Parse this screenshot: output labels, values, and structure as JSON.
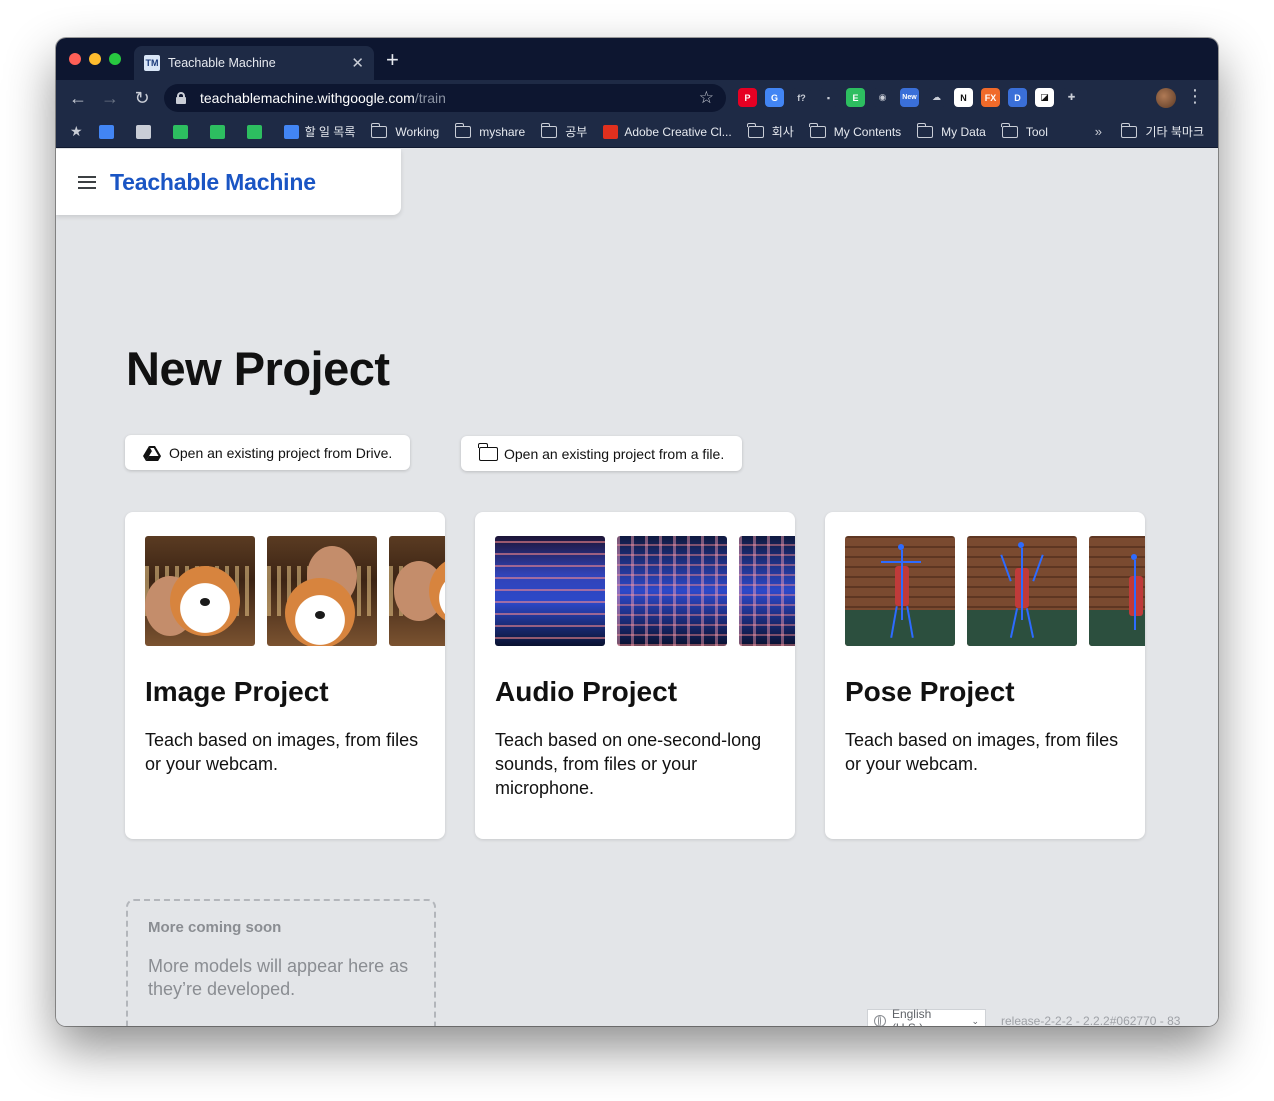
{
  "browser": {
    "tab_title": "Teachable Machine",
    "tab_favicon": "TM",
    "url_host": "teachablemachine.withgoogle.com",
    "url_path": "/train",
    "extensions": [
      {
        "icon": "pinterest-icon",
        "color": "#e60023",
        "label": "P"
      },
      {
        "icon": "translate-icon",
        "color": "#4285f4",
        "label": "G"
      },
      {
        "icon": "formula-icon",
        "color": "#1e2a45",
        "label": "f?"
      },
      {
        "icon": "screen-icon",
        "color": "#1e2a45",
        "label": "▪"
      },
      {
        "icon": "evernote-icon",
        "color": "#2dbe60",
        "label": "E"
      },
      {
        "icon": "camera-icon",
        "color": "#1e2a45",
        "label": "◉"
      },
      {
        "icon": "new-badge-icon",
        "color": "#3a6fd8",
        "label": "New"
      },
      {
        "icon": "cloud-icon",
        "color": "#1e2a45",
        "label": "☁"
      },
      {
        "icon": "notion-icon",
        "color": "#ffffff",
        "label": "N"
      },
      {
        "icon": "fx-icon",
        "color": "#f06a2a",
        "label": "FX"
      },
      {
        "icon": "docs-icon",
        "color": "#3a6fd8",
        "label": "D"
      },
      {
        "icon": "split-icon",
        "color": "#ffffff",
        "label": "◪"
      },
      {
        "icon": "puzzle-icon",
        "color": "#1e2a45",
        "label": "✚"
      }
    ]
  },
  "bookmarks": {
    "items": [
      {
        "type": "icon",
        "icon": "translate-icon",
        "color": "#4285f4",
        "label": ""
      },
      {
        "type": "icon",
        "icon": "apps-grid-icon",
        "color": "#c9cdd6",
        "label": ""
      },
      {
        "type": "icon",
        "icon": "bell-icon",
        "color": "#2dbe60",
        "label": ""
      },
      {
        "type": "icon",
        "icon": "blog-icon",
        "color": "#2dbe60",
        "label": ""
      },
      {
        "type": "icon",
        "icon": "evernote-icon",
        "color": "#2dbe60",
        "label": ""
      },
      {
        "type": "icon",
        "icon": "calendar-icon",
        "color": "#4285f4",
        "label": "할 일 목록"
      },
      {
        "type": "folder",
        "label": "Working"
      },
      {
        "type": "folder",
        "label": "myshare"
      },
      {
        "type": "folder",
        "label": "공부"
      },
      {
        "type": "icon",
        "icon": "adobe-icon",
        "color": "#e0301e",
        "label": "Adobe Creative Cl..."
      },
      {
        "type": "folder",
        "label": "회사"
      },
      {
        "type": "folder",
        "label": "My Contents"
      },
      {
        "type": "folder",
        "label": "My Data"
      },
      {
        "type": "folder",
        "label": "Tool"
      }
    ],
    "overflow": "»",
    "other_label": "기타 북마크"
  },
  "header": {
    "brand": "Teachable Machine"
  },
  "main": {
    "title": "New Project",
    "open_drive_label": "Open an existing project from Drive.",
    "open_file_label": "Open an existing project from a file.",
    "projects": [
      {
        "title": "Image Project",
        "description": "Teach based on images, from files or your webcam."
      },
      {
        "title": "Audio Project",
        "description": "Teach based on one-second-long sounds, from files or your microphone."
      },
      {
        "title": "Pose Project",
        "description": "Teach based on images, from files or your webcam."
      }
    ],
    "coming_soon": {
      "title": "More coming soon",
      "description": "More models will appear here as they’re developed."
    }
  },
  "footer": {
    "language": "English (U.S.)",
    "release": "release-2-2-2 - 2.2.2#062770 - 83"
  },
  "colors": {
    "brand_blue": "#1a55c4",
    "page_bg": "#e3e5e8",
    "chrome_dark": "#1e2a45"
  }
}
